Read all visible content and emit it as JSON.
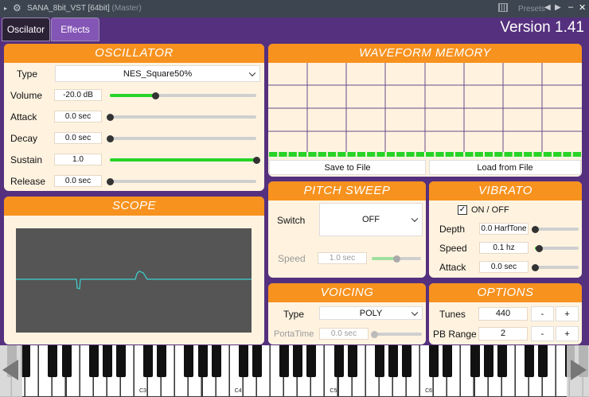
{
  "titlebar": {
    "title": "SANA_8bit_VST [64bit]",
    "subtitle": "(Master)",
    "presets": "Presets"
  },
  "tabs": [
    {
      "label": "Oscilator"
    },
    {
      "label": "Effects"
    }
  ],
  "version": "Version 1.41",
  "oscillator": {
    "title": "OSCILLATOR",
    "type_label": "Type",
    "type_value": "NES_Square50%",
    "params": [
      {
        "label": "Volume",
        "value": "-20.0 dB",
        "level": 0.31
      },
      {
        "label": "Attack",
        "value": "0.0 sec",
        "level": 0
      },
      {
        "label": "Decay",
        "value": "0.0 sec",
        "level": 0
      },
      {
        "label": "Sustain",
        "value": "1.0",
        "level": 1
      },
      {
        "label": "Release",
        "value": "0.0 sec",
        "level": 0
      }
    ]
  },
  "scope": {
    "title": "SCOPE"
  },
  "waveform": {
    "title": "WAVEFORM MEMORY",
    "save_label": "Save to File",
    "load_label": "Load from File",
    "cells": 32
  },
  "pitch_sweep": {
    "title": "PITCH SWEEP",
    "switch_label": "Switch",
    "switch_value": "OFF",
    "speed_label": "Speed",
    "speed_value": "1.0 sec",
    "speed_level": 0.5
  },
  "vibrato": {
    "title": "VIBRATO",
    "onoff_label": "ON / OFF",
    "onoff_checked": true,
    "params": [
      {
        "label": "Depth",
        "value": "0.0 HarfTone",
        "level": 0
      },
      {
        "label": "Speed",
        "value": "0.1 hz",
        "level": 0.1
      },
      {
        "label": "Attack",
        "value": "0.0 sec",
        "level": 0
      }
    ]
  },
  "voicing": {
    "title": "VOICING",
    "type_label": "Type",
    "type_value": "POLY",
    "porta_label": "PortaTime",
    "porta_value": "0.0 sec",
    "porta_level": 0
  },
  "options": {
    "title": "OPTIONS",
    "tunes_label": "Tunes",
    "tunes_value": "440",
    "pb_label": "PB Range",
    "pb_value": "2",
    "minus": "-",
    "plus": "+"
  },
  "keyboard": {
    "notes": [
      "C3",
      "C4",
      "C5",
      "C6"
    ]
  },
  "colors": {
    "accent": "#f7921e",
    "panel": "#fff3e0",
    "background": "#55307e",
    "slider_fill": "#27d327",
    "scope_bg": "#555555",
    "scope_line": "#3fd0d0"
  }
}
